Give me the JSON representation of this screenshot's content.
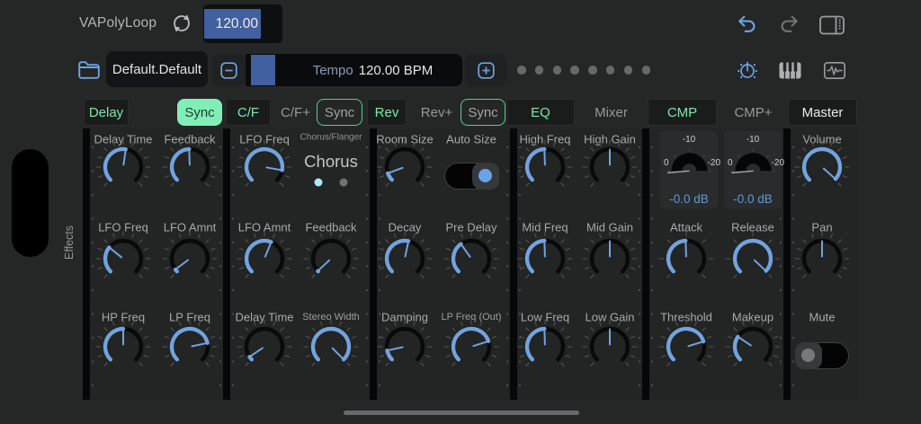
{
  "topbar": {
    "patch_name": "VAPolyLoop",
    "tempo_field_value": "120.00"
  },
  "transport": {
    "preset_name": "Default.Default",
    "tempo_label": "Tempo",
    "tempo_value": "120.00 BPM",
    "page_dot_count": 8
  },
  "tabs": [
    {
      "label": "Delay",
      "style": "box"
    },
    {
      "label": "Sync",
      "style": "filled"
    },
    {
      "label": "C/F",
      "style": "box"
    },
    {
      "label": "C/F+",
      "style": "plain"
    },
    {
      "label": "Sync",
      "style": "outline"
    },
    {
      "label": "Rev",
      "style": "box"
    },
    {
      "label": "Rev+",
      "style": "plain"
    },
    {
      "label": "Sync",
      "style": "outline"
    },
    {
      "label": "EQ",
      "style": "box"
    },
    {
      "label": "Mixer",
      "style": "plain"
    },
    {
      "label": "CMP",
      "style": "box"
    },
    {
      "label": "CMP+",
      "style": "plain"
    },
    {
      "label": "Master",
      "style": "box-white"
    }
  ],
  "rack": {
    "side_label": "Effects"
  },
  "icons": [
    "sync-loop",
    "undo",
    "redo",
    "sidebar-panel",
    "folder",
    "minus",
    "plus",
    "knob-panel",
    "keyboard",
    "waveform"
  ],
  "panels": [
    {
      "name": "delay",
      "controls": [
        {
          "type": "knob",
          "label": "Delay Time",
          "angle": 8,
          "col": 0,
          "row": 0
        },
        {
          "type": "knob",
          "label": "Feedback",
          "angle": -2,
          "col": 1,
          "row": 0
        },
        {
          "type": "knob",
          "label": "LFO Freq",
          "angle": -51,
          "col": 0,
          "row": 1
        },
        {
          "type": "knob",
          "label": "LFO Amnt",
          "angle": -127,
          "col": 1,
          "row": 1
        },
        {
          "type": "knob",
          "label": "HP Freq",
          "angle": 0,
          "col": 0,
          "row": 2
        },
        {
          "type": "knob",
          "label": "LP Freq",
          "angle": 78,
          "col": 1,
          "row": 2
        }
      ]
    },
    {
      "name": "chorus-flanger",
      "controls": [
        {
          "type": "knob",
          "label": "LFO Freq",
          "angle": 100,
          "col": 0,
          "row": 0
        },
        {
          "type": "selector",
          "label": "Chorus/Flanger",
          "value": "Chorus",
          "col": 1,
          "row": 0,
          "dot_active_color": "#a9e9f5",
          "dot_inactive_color": "#6f7173"
        },
        {
          "type": "knob",
          "label": "LFO Amnt",
          "angle": 22,
          "col": 0,
          "row": 1
        },
        {
          "type": "knob",
          "label": "Feedback",
          "angle": -133,
          "col": 1,
          "row": 1
        },
        {
          "type": "knob",
          "label": "Delay Time",
          "angle": -124,
          "col": 0,
          "row": 2
        },
        {
          "type": "knob",
          "label": "Stereo Width",
          "angle": 135,
          "col": 1,
          "row": 2,
          "small_label": true
        }
      ]
    },
    {
      "name": "reverb",
      "controls": [
        {
          "type": "knob",
          "label": "Room Size",
          "angle": -110,
          "col": 0,
          "row": 0
        },
        {
          "type": "toggle",
          "label": "Auto Size",
          "state": "on",
          "col": 1,
          "row": 0
        },
        {
          "type": "knob",
          "label": "Decay",
          "angle": 12,
          "col": 0,
          "row": 1
        },
        {
          "type": "knob",
          "label": "Pre Delay",
          "angle": -35,
          "col": 1,
          "row": 1
        },
        {
          "type": "knob",
          "label": "Damping",
          "angle": -102,
          "col": 0,
          "row": 2
        },
        {
          "type": "knob",
          "label": "LP Freq (Out)",
          "angle": 72,
          "col": 1,
          "row": 2,
          "small_label": true
        }
      ]
    },
    {
      "name": "eq",
      "controls": [
        {
          "type": "knob",
          "label": "High Freq",
          "angle": -2,
          "col": 0,
          "row": 0
        },
        {
          "type": "knob",
          "label": "High Gain",
          "angle": 0,
          "bipolar": true,
          "col": 1,
          "row": 0
        },
        {
          "type": "knob",
          "label": "Mid Freq",
          "angle": -2,
          "col": 0,
          "row": 1
        },
        {
          "type": "knob",
          "label": "Mid Gain",
          "angle": 0,
          "bipolar": true,
          "col": 1,
          "row": 1
        },
        {
          "type": "knob",
          "label": "Low Freq",
          "angle": -2,
          "col": 0,
          "row": 2
        },
        {
          "type": "knob",
          "label": "Low Gain",
          "angle": 0,
          "bipolar": true,
          "col": 1,
          "row": 2
        }
      ]
    },
    {
      "name": "compressor",
      "controls": [
        {
          "type": "meter",
          "scale_top": "-10",
          "scale_left": "0",
          "scale_right": "-20",
          "value": "-0.0 dB",
          "col": 0,
          "row": 0
        },
        {
          "type": "meter",
          "scale_top": "-10",
          "scale_left": "0",
          "scale_right": "-20",
          "value": "-0.0 dB",
          "col": 1,
          "row": 0
        },
        {
          "type": "knob",
          "label": "Attack",
          "angle": -2,
          "ticks": 7,
          "col": 0,
          "row": 1
        },
        {
          "type": "knob",
          "label": "Release",
          "angle": 133,
          "ticks": 7,
          "col": 1,
          "row": 1
        },
        {
          "type": "knob",
          "label": "Threshold",
          "angle": 73,
          "col": 0,
          "row": 2
        },
        {
          "type": "knob",
          "label": "Makeup",
          "angle": -56,
          "col": 1,
          "row": 2
        }
      ]
    },
    {
      "name": "master",
      "controls": [
        {
          "type": "knob",
          "label": "Volume",
          "angle": 132,
          "col": 0,
          "row": 0
        },
        {
          "type": "knob",
          "label": "Pan",
          "angle": 0,
          "bipolar": true,
          "col": 0,
          "row": 1
        },
        {
          "type": "toggle",
          "label": "Mute",
          "state": "off",
          "col": 0,
          "row": 2
        }
      ]
    }
  ],
  "colors": {
    "accent_blue": "#72a3de",
    "accent_green": "#7de6b0",
    "toggle_on_dot": "#6ba4e6",
    "toggle_off_dot": "#77797b"
  }
}
